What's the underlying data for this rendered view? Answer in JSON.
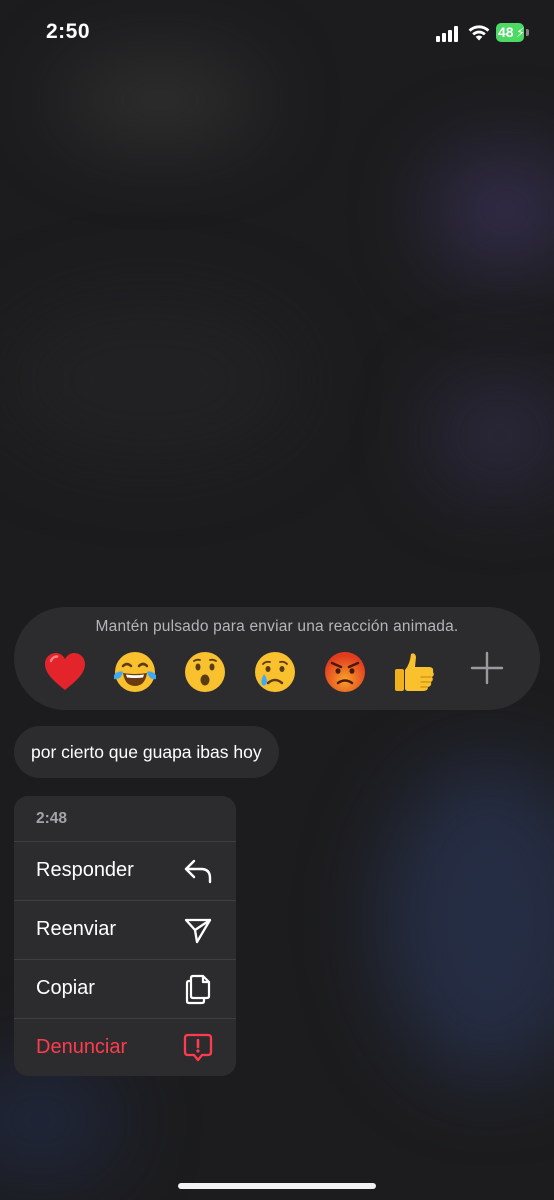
{
  "status_bar": {
    "time": "2:50",
    "battery_level": "48",
    "icons": [
      "cellular-signal-icon",
      "wifi-icon",
      "battery-charging-icon"
    ]
  },
  "reaction_bar": {
    "hint": "Mantén pulsado para enviar una reacción animada.",
    "reactions": [
      {
        "name": "heart-emoji",
        "glyph": "❤️"
      },
      {
        "name": "tears-of-joy-emoji",
        "glyph": "😂"
      },
      {
        "name": "surprised-emoji",
        "glyph": "😮"
      },
      {
        "name": "crying-emoji",
        "glyph": "😢"
      },
      {
        "name": "angry-emoji",
        "glyph": "😡"
      },
      {
        "name": "thumbs-up-emoji",
        "glyph": "👍"
      }
    ],
    "more_icon": "plus-icon"
  },
  "message": {
    "text": "por cierto que guapa ibas hoy"
  },
  "context_menu": {
    "timestamp": "2:48",
    "items": [
      {
        "label": "Responder",
        "icon": "reply-icon"
      },
      {
        "label": "Reenviar",
        "icon": "send-icon"
      },
      {
        "label": "Copiar",
        "icon": "copy-icon"
      },
      {
        "label": "Denunciar",
        "icon": "report-icon",
        "destructive": true
      }
    ]
  },
  "colors": {
    "background": "#1c1c1e",
    "surface": "#2c2c2e",
    "destructive": "#ff3b4e",
    "battery": "#4cd964"
  }
}
